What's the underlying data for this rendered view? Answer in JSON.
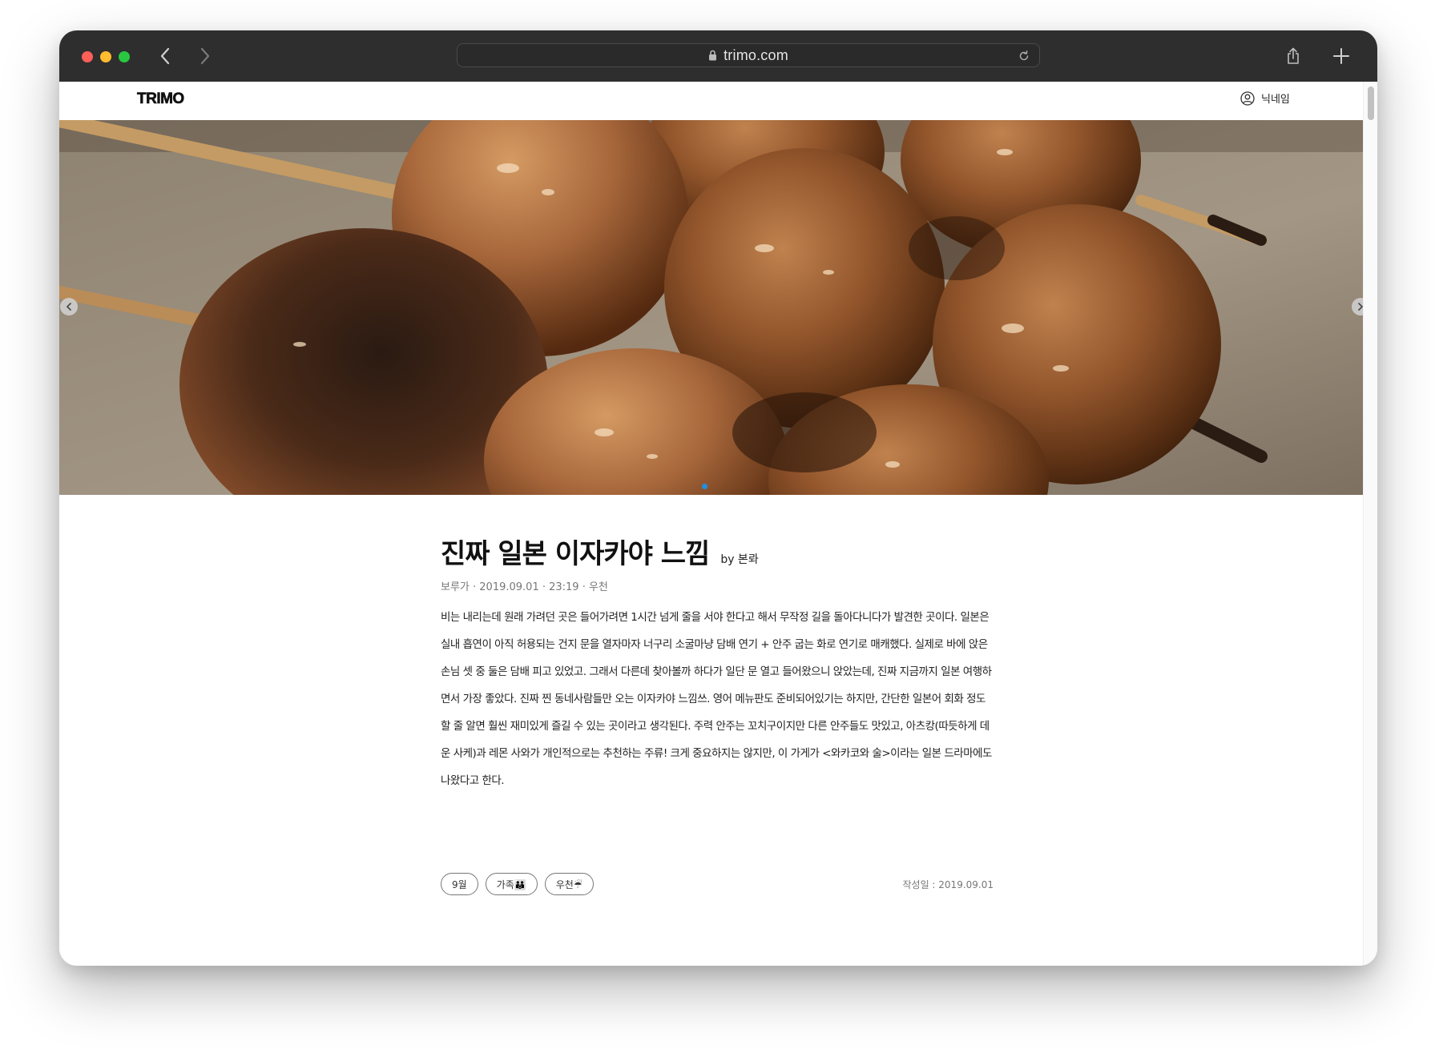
{
  "browser": {
    "url": "trimo.com"
  },
  "site": {
    "logo": "TRIMO",
    "user_name": "닉네임"
  },
  "article": {
    "title": "진짜 일본 이자카야 느낌",
    "byline": "by 본롸",
    "meta": "보루가 · 2019.09.01 · 23:19 · 우천",
    "body": "비는 내리는데 원래 가려던 곳은 들어가려면 1시간 넘게 줄을 서야 한다고 해서 무작정 길을 돌아다니다가 발견한 곳이다. 일본은 실내 흡연이 아직 허용되는 건지 문을 열자마자 너구리 소굴마냥 담배 연기 + 안주 굽는 화로 연기로 매캐했다. 실제로 바에 앉은 손님 셋 중 둘은 담배 피고 있었고. 그래서 다른데 찾아볼까 하다가 일단 문 열고 들어왔으니 앉았는데, 진짜 지금까지 일본 여행하면서 가장 좋았다. 진짜 찐 동네사람들만 오는 이자카야 느낌쓰. 영어 메뉴판도 준비되어있기는 하지만, 간단한 일본어 회화 정도 할 줄 알면 훨씬 재미있게 즐길 수 있는 곳이라고 생각된다. 주력 안주는 꼬치구이지만 다른 안주들도 맛있고, 아츠캉(따듯하게 데운 사케)과 레몬 사와가 개인적으로는 추천하는 주류! 크게 중요하지는 않지만, 이 가게가 <와카코와 술>이라는 일본 드라마에도 나왔다고 한다.",
    "tags": [
      {
        "label": "9월"
      },
      {
        "label": "가족👪"
      },
      {
        "label": "우천☔"
      }
    ],
    "written_date": "작성일 : 2019.09.01"
  },
  "icons": {
    "lock": "lock-icon",
    "reload": "reload-icon",
    "back": "chevron-left-icon",
    "forward": "chevron-right-icon",
    "share": "share-icon",
    "new_tab": "plus-icon",
    "user": "user-circle-icon"
  },
  "colors": {
    "chrome_bg": "#2e2e2f",
    "carousel_dot": "#1e8fe1"
  }
}
